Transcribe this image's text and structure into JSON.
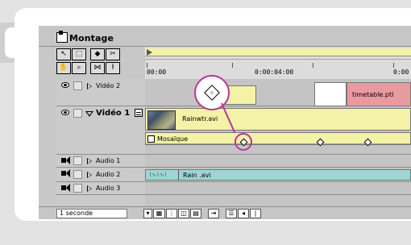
{
  "window": {
    "title": "Montage"
  },
  "toolbar": {
    "tools": [
      {
        "name": "selection-tool",
        "glyph": "↖"
      },
      {
        "name": "marquee-tool",
        "glyph": "⬚"
      },
      {
        "name": "split-tool",
        "glyph": "◆"
      },
      {
        "name": "razor-tool",
        "glyph": "✂"
      },
      {
        "name": "hand-tool",
        "glyph": "✋"
      },
      {
        "name": "zoom-tool",
        "glyph": "🔍"
      },
      {
        "name": "link-tool",
        "glyph": "⋈"
      },
      {
        "name": "in-out-tool",
        "glyph": "ł"
      }
    ]
  },
  "ruler": {
    "labels": [
      "00:00",
      "0:00:04:00",
      "0:00"
    ]
  },
  "tracks": {
    "video2": {
      "name": "Vidéo 2",
      "clip": "timetable.ptl"
    },
    "video1": {
      "name": "Vidéo 1",
      "clip": "Rainwtr.avi",
      "effect": "Mosaïque"
    },
    "audio1": {
      "name": "Audio 1"
    },
    "audio2": {
      "name": "Audio 2",
      "clip": "Rain .avi"
    },
    "audio3": {
      "name": "Audio 3"
    }
  },
  "status": {
    "zoom_value": "1 seconde"
  },
  "colors": {
    "video_clip": "#f3f2a6",
    "title_clip": "#e99aa0",
    "audio_clip": "#9dd6d3",
    "highlight_ring": "#b8359a"
  }
}
